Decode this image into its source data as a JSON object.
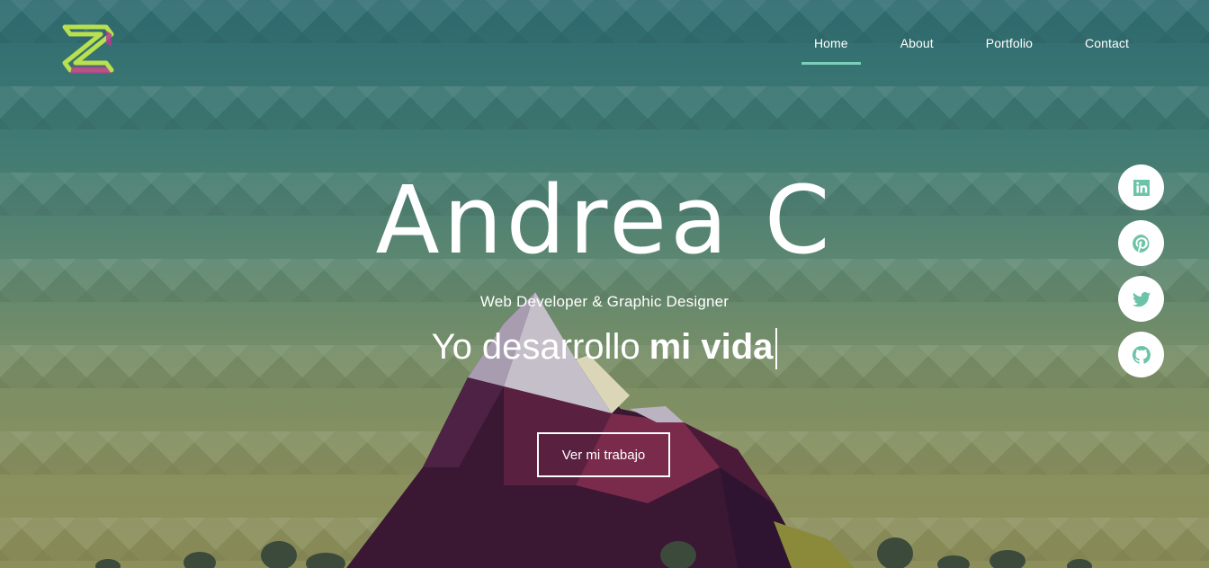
{
  "brand": {
    "logo_icon": "ambigram-logo-icon",
    "colors": [
      "#b9e04e",
      "#b13d8e",
      "#f3f0c8"
    ]
  },
  "nav": {
    "items": [
      {
        "label": "Home",
        "active": true
      },
      {
        "label": "About",
        "active": false
      },
      {
        "label": "Portfolio",
        "active": false
      },
      {
        "label": "Contact",
        "active": false
      }
    ],
    "active_color": "#7cd0b9"
  },
  "hero": {
    "name": "Andrea C",
    "subtitle": "Web Developer & Graphic Designer",
    "typed_prefix": "Yo desarrollo",
    "typed_word": "mi vida",
    "cta_label": "Ver mi trabajo"
  },
  "social": {
    "icons": [
      "linkedin-icon",
      "pinterest-icon",
      "twitter-icon",
      "github-icon"
    ],
    "icon_color": "#6bc4a8"
  }
}
